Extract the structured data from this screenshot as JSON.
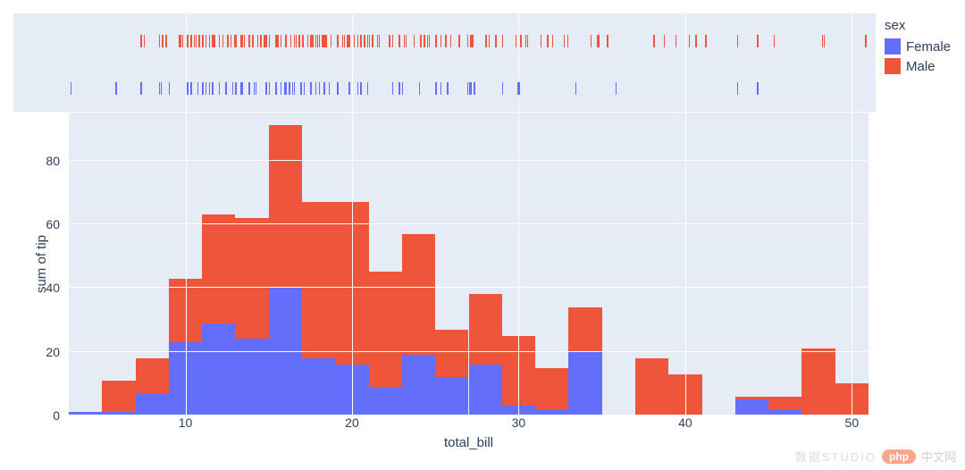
{
  "legend": {
    "title": "sex",
    "items": [
      {
        "label": "Female",
        "color": "#636efa"
      },
      {
        "label": "Male",
        "color": "#ef553b"
      }
    ]
  },
  "axes": {
    "x": {
      "label": "total_bill",
      "ticks": [
        10,
        20,
        30,
        40,
        50
      ],
      "range": [
        3,
        51
      ]
    },
    "y": {
      "label": "sum of tip",
      "ticks": [
        0,
        20,
        40,
        60,
        80
      ],
      "range": [
        0,
        95
      ]
    }
  },
  "watermark": {
    "left": "数据STUDIO",
    "pill": "php",
    "right": "中文网"
  },
  "chart_data": {
    "type": "bar",
    "title": "",
    "xlabel": "total_bill",
    "ylabel": "sum of tip",
    "xlim": [
      3,
      51
    ],
    "ylim": [
      0,
      95
    ],
    "stacked": true,
    "bin_width": 2,
    "categories": [
      4,
      6,
      8,
      10,
      12,
      14,
      16,
      18,
      20,
      22,
      24,
      26,
      28,
      30,
      32,
      34,
      36,
      38,
      40,
      42,
      44,
      46,
      48,
      50
    ],
    "series": [
      {
        "name": "Female",
        "color": "#636efa",
        "values": [
          1,
          1,
          7,
          23,
          29,
          24,
          40,
          18,
          16,
          9,
          19,
          12,
          16,
          3,
          2,
          20,
          0,
          0,
          0,
          0,
          5,
          2,
          0,
          0
        ]
      },
      {
        "name": "Male",
        "color": "#ef553b",
        "values": [
          0,
          10,
          11,
          20,
          34,
          38,
          51,
          49,
          51,
          36,
          38,
          15,
          22,
          22,
          13,
          14,
          0,
          18,
          13,
          0,
          1,
          4,
          21,
          10
        ]
      }
    ],
    "rug_panel": {
      "rows": [
        {
          "name": "Male",
          "color": "#ef553b",
          "y": 0.3,
          "x": [
            7.3,
            7.5,
            8.4,
            8.6,
            8.8,
            9.6,
            9.7,
            9.8,
            10.1,
            10.3,
            10.3,
            10.3,
            10.5,
            10.6,
            10.8,
            11.0,
            11.2,
            11.4,
            11.6,
            11.7,
            12.0,
            12.2,
            12.5,
            12.5,
            12.7,
            12.9,
            13.0,
            13.0,
            13.0,
            13.3,
            13.4,
            13.5,
            13.5,
            13.8,
            14.0,
            14.0,
            14.3,
            14.5,
            14.7,
            14.8,
            15.0,
            15.0,
            15.4,
            15.5,
            15.5,
            15.7,
            15.7,
            16.0,
            16.0,
            16.3,
            16.3,
            16.5,
            16.6,
            16.8,
            17.0,
            17.3,
            17.5,
            17.6,
            17.8,
            17.9,
            18.0,
            18.2,
            18.3,
            18.3,
            18.4,
            18.7,
            18.7,
            19.1,
            19.4,
            19.5,
            19.7,
            19.8,
            20.1,
            20.3,
            20.5,
            20.7,
            20.7,
            20.9,
            21.0,
            21.0,
            21.2,
            21.5,
            21.6,
            22.2,
            22.4,
            22.8,
            23.1,
            23.2,
            23.7,
            24.1,
            24.3,
            24.5,
            24.6,
            25.0,
            25.3,
            25.6,
            25.9,
            26.4,
            26.9,
            27.1,
            27.2,
            28.0,
            28.2,
            28.6,
            29.0,
            29.8,
            30.1,
            30.4,
            30.5,
            31.3,
            31.7,
            32.0,
            32.7,
            32.9,
            34.3,
            34.7,
            34.8,
            34.8,
            35.3,
            38.1,
            38.7,
            39.4,
            40.2,
            40.6,
            41.2,
            43.1,
            44.3,
            45.3,
            48.2,
            48.3,
            48.3,
            50.8
          ]
        },
        {
          "name": "Female",
          "color": "#636efa",
          "y": 0.78,
          "x": [
            3.1,
            5.8,
            7.3,
            8.4,
            8.5,
            9.0,
            10.1,
            10.1,
            10.3,
            10.3,
            10.7,
            11.0,
            11.2,
            11.4,
            11.6,
            12.0,
            12.4,
            12.8,
            13.0,
            13.3,
            13.4,
            13.4,
            13.8,
            14.1,
            14.2,
            14.8,
            15.0,
            15.4,
            15.7,
            15.9,
            16.0,
            16.0,
            16.2,
            16.4,
            16.5,
            16.9,
            17.1,
            17.5,
            17.8,
            18.0,
            18.3,
            18.6,
            19.1,
            19.8,
            20.3,
            20.5,
            20.9,
            22.4,
            22.8,
            23.0,
            24.0,
            25.0,
            25.3,
            25.3,
            25.7,
            26.9,
            27.0,
            27.1,
            27.3,
            29.0,
            29.9,
            30.0,
            33.4,
            35.8,
            43.1,
            44.3
          ]
        }
      ]
    }
  }
}
